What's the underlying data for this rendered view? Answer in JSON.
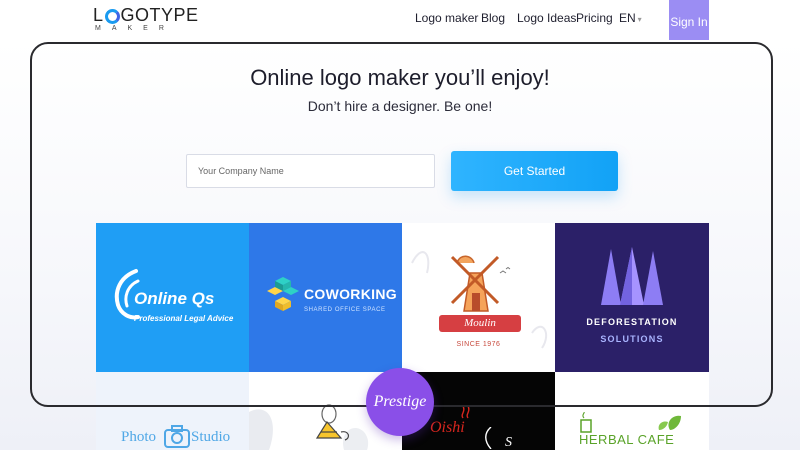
{
  "header": {
    "logo_main_left": "L",
    "logo_main_right": "GOTYPE",
    "logo_sub": "MAKER",
    "nav": [
      "Logo maker",
      "Blog",
      "Logo Ideas",
      "Pricing"
    ],
    "language": "EN",
    "signin_label": "Sign In"
  },
  "hero": {
    "title": "Online logo maker you’ll enjoy!",
    "subtitle": "Don’t hire a designer. Be one!",
    "input_placeholder": "Your Company Name",
    "cta_label": "Get Started"
  },
  "cards": {
    "online": {
      "name": "Online Qs",
      "tagline": "Professional Legal Advice"
    },
    "coworking": {
      "name": "COWORKING",
      "tagline": "SHARED OFFICE SPACE"
    },
    "moulin": {
      "name": "Moulin",
      "since": "SINCE 1976"
    },
    "deforestation": {
      "line1": "DEFORESTATION",
      "line2": "SOLUTIONS"
    },
    "photo": {
      "word1": "Photo",
      "word2": "Studio"
    },
    "oishi": {
      "name": "Oishi",
      "extra": "S"
    },
    "herbal": {
      "name": "HERBAL CAFE"
    }
  },
  "badge": {
    "label": "Prestige"
  },
  "colors": {
    "accent": "#1a9bf0",
    "signin_bg": "#9b8df3",
    "cta": "#12a2f6",
    "badge": "#8a4fe8"
  }
}
